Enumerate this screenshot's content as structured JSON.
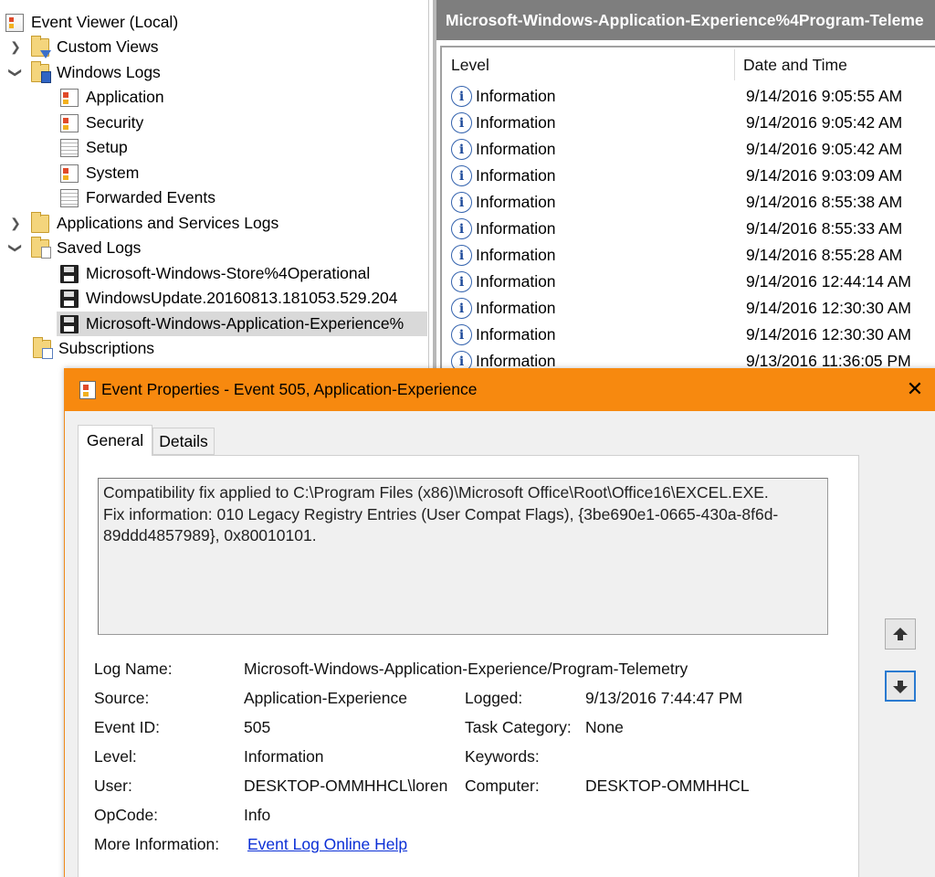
{
  "tree": {
    "items": [
      {
        "label": "Event Viewer (Local)",
        "icon": "event-viewer-icon"
      },
      {
        "label": "Custom Views",
        "icon": "custom-views-folder-icon",
        "expander": ">"
      },
      {
        "label": "Windows Logs",
        "icon": "windows-logs-folder-icon",
        "expander": "v"
      },
      {
        "label": "Application",
        "icon": "log-icon"
      },
      {
        "label": "Security",
        "icon": "log-icon"
      },
      {
        "label": "Setup",
        "icon": "log-icon"
      },
      {
        "label": "System",
        "icon": "log-icon"
      },
      {
        "label": "Forwarded Events",
        "icon": "log-icon"
      },
      {
        "label": "Applications and Services Logs",
        "icon": "folder-icon",
        "expander": ">"
      },
      {
        "label": "Saved Logs",
        "icon": "saved-logs-folder-icon",
        "expander": "v"
      },
      {
        "label": "Microsoft-Windows-Store%4Operational",
        "icon": "saved-log-disk-icon"
      },
      {
        "label": "WindowsUpdate.20160813.181053.529.204",
        "icon": "saved-log-disk-icon"
      },
      {
        "label": "Microsoft-Windows-Application-Experience%",
        "icon": "saved-log-disk-icon",
        "selected": true
      },
      {
        "label": "Subscriptions",
        "icon": "subscriptions-icon"
      }
    ]
  },
  "list": {
    "title": "Microsoft-Windows-Application-Experience%4Program-Teleme",
    "columns": {
      "level": "Level",
      "date": "Date and Time"
    },
    "rows": [
      {
        "level": "Information",
        "date": "9/14/2016 9:05:55 AM"
      },
      {
        "level": "Information",
        "date": "9/14/2016 9:05:42 AM"
      },
      {
        "level": "Information",
        "date": "9/14/2016 9:05:42 AM"
      },
      {
        "level": "Information",
        "date": "9/14/2016 9:03:09 AM"
      },
      {
        "level": "Information",
        "date": "9/14/2016 8:55:38 AM"
      },
      {
        "level": "Information",
        "date": "9/14/2016 8:55:33 AM"
      },
      {
        "level": "Information",
        "date": "9/14/2016 8:55:28 AM"
      },
      {
        "level": "Information",
        "date": "9/14/2016 12:44:14 AM"
      },
      {
        "level": "Information",
        "date": "9/14/2016 12:30:30 AM"
      },
      {
        "level": "Information",
        "date": "9/14/2016 12:30:30 AM"
      },
      {
        "level": "Information",
        "date": "9/13/2016 11:36:05 PM"
      }
    ]
  },
  "dialog": {
    "title": "Event Properties - Event 505, Application-Experience",
    "close": "✕",
    "tabs": {
      "general": "General",
      "details": "Details"
    },
    "description": [
      "Compatibility fix applied to C:\\Program Files (x86)\\Microsoft Office\\Root\\Office16\\EXCEL.EXE.",
      "Fix information: 010 Legacy Registry Entries (User Compat Flags), {3be690e1-0665-430a-8f6d-",
      "89ddd4857989}, 0x80010101."
    ],
    "fields": {
      "log_name_label": "Log Name:",
      "log_name": "Microsoft-Windows-Application-Experience/Program-Telemetry",
      "source_label": "Source:",
      "source": "Application-Experience",
      "logged_label": "Logged:",
      "logged": "9/13/2016 7:44:47 PM",
      "event_id_label": "Event ID:",
      "event_id": "505",
      "task_category_label": "Task Category:",
      "task_category": "None",
      "level_label": "Level:",
      "level": "Information",
      "keywords_label": "Keywords:",
      "keywords": "",
      "user_label": "User:",
      "user": "DESKTOP-OMMHHCL\\loren",
      "computer_label": "Computer:",
      "computer": "DESKTOP-OMMHHCL",
      "opcode_label": "OpCode:",
      "opcode": "Info",
      "more_info_label": "More Information:",
      "more_info_link": "Event Log Online Help"
    }
  },
  "colors": {
    "dialog_title_bar": "#f7890f",
    "list_title_bar": "#7e7e7e",
    "selection": "#d9d9d9",
    "link": "#0b2fd6"
  }
}
